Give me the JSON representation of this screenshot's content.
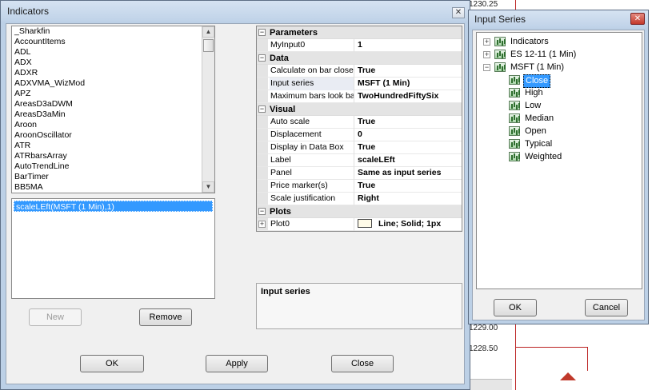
{
  "background": {
    "prices": [
      "1229.00",
      "1228.50"
    ],
    "partial_top_price": "1230.25"
  },
  "indicators_dialog": {
    "title": "Indicators",
    "indicator_list": [
      "_Sharkfin",
      "AccountItems",
      "ADL",
      "ADX",
      "ADXR",
      "ADXVMA_WizMod",
      "APZ",
      "AreasD3aDWM",
      "AreasD3aMin",
      "Aroon",
      "AroonOscillator",
      "ATR",
      "ATRbarsArray",
      "AutoTrendLine",
      "BarTimer",
      "BB5MA"
    ],
    "selected_indicators": [
      "scaleLEft(MSFT (1 Min),1)"
    ],
    "buttons": {
      "new": "New",
      "remove": "Remove",
      "ok": "OK",
      "apply": "Apply",
      "close": "Close"
    },
    "properties": {
      "categories": {
        "parameters": "Parameters",
        "data": "Data",
        "visual": "Visual",
        "plots": "Plots"
      },
      "parameters": [
        {
          "name": "MyInput0",
          "value": "1"
        }
      ],
      "data": [
        {
          "name": "Calculate on bar close",
          "value": "True"
        },
        {
          "name": "Input series",
          "value": "MSFT (1 Min)"
        },
        {
          "name": "Maximum bars look back",
          "value": "TwoHundredFiftySix"
        }
      ],
      "visual": [
        {
          "name": "Auto scale",
          "value": "True"
        },
        {
          "name": "Displacement",
          "value": "0"
        },
        {
          "name": "Display in Data Box",
          "value": "True"
        },
        {
          "name": "Label",
          "value": "scaleLEft"
        },
        {
          "name": "Panel",
          "value": "Same as input series"
        },
        {
          "name": "Price marker(s)",
          "value": "True"
        },
        {
          "name": "Scale justification",
          "value": "Right"
        }
      ],
      "plots": [
        {
          "name": "Plot0",
          "value": "Line; Solid; 1px"
        }
      ]
    },
    "description_title": "Input series"
  },
  "input_series_dialog": {
    "title": "Input Series",
    "tree": {
      "indicators": "Indicators",
      "es": "ES 12-11 (1 Min)",
      "msft": "MSFT (1 Min)",
      "children": [
        "Close",
        "High",
        "Low",
        "Median",
        "Open",
        "Typical",
        "Weighted"
      ],
      "selected": "Close"
    },
    "buttons": {
      "ok": "OK",
      "cancel": "Cancel"
    }
  },
  "colors": {
    "selection": "#3399ff",
    "title_bar": "#bfd2e8",
    "chart_line": "#bb2222"
  }
}
